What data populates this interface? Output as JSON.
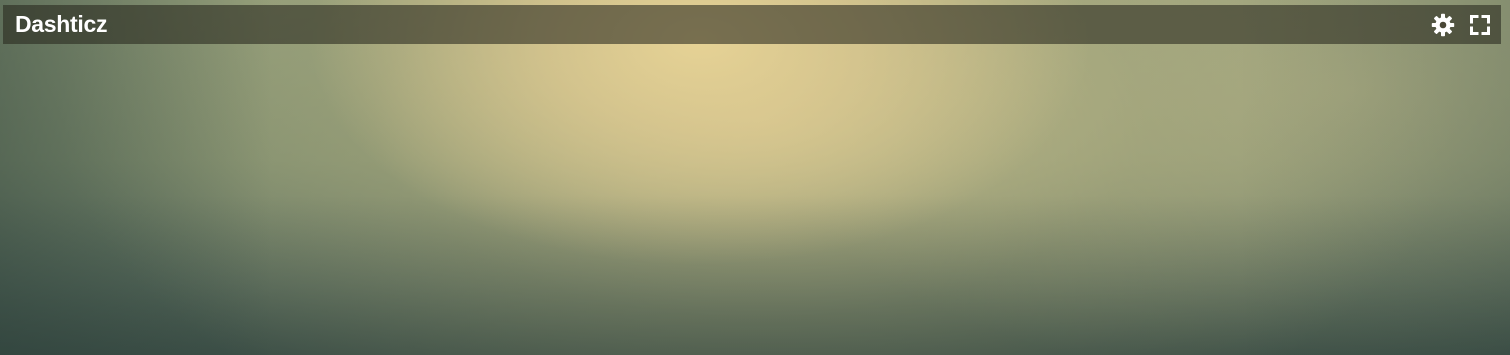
{
  "app": {
    "title": "Dashticz"
  },
  "header": {
    "actions": [
      {
        "icon": "gear-icon",
        "label": "settings"
      },
      {
        "icon": "fullscreen-icon",
        "label": "fullscreen"
      }
    ]
  },
  "colors": {
    "header_bg": "#3c3a2c",
    "header_text": "#ffffff",
    "background_top": "#e6d498",
    "background_bottom": "#4a5c52"
  }
}
